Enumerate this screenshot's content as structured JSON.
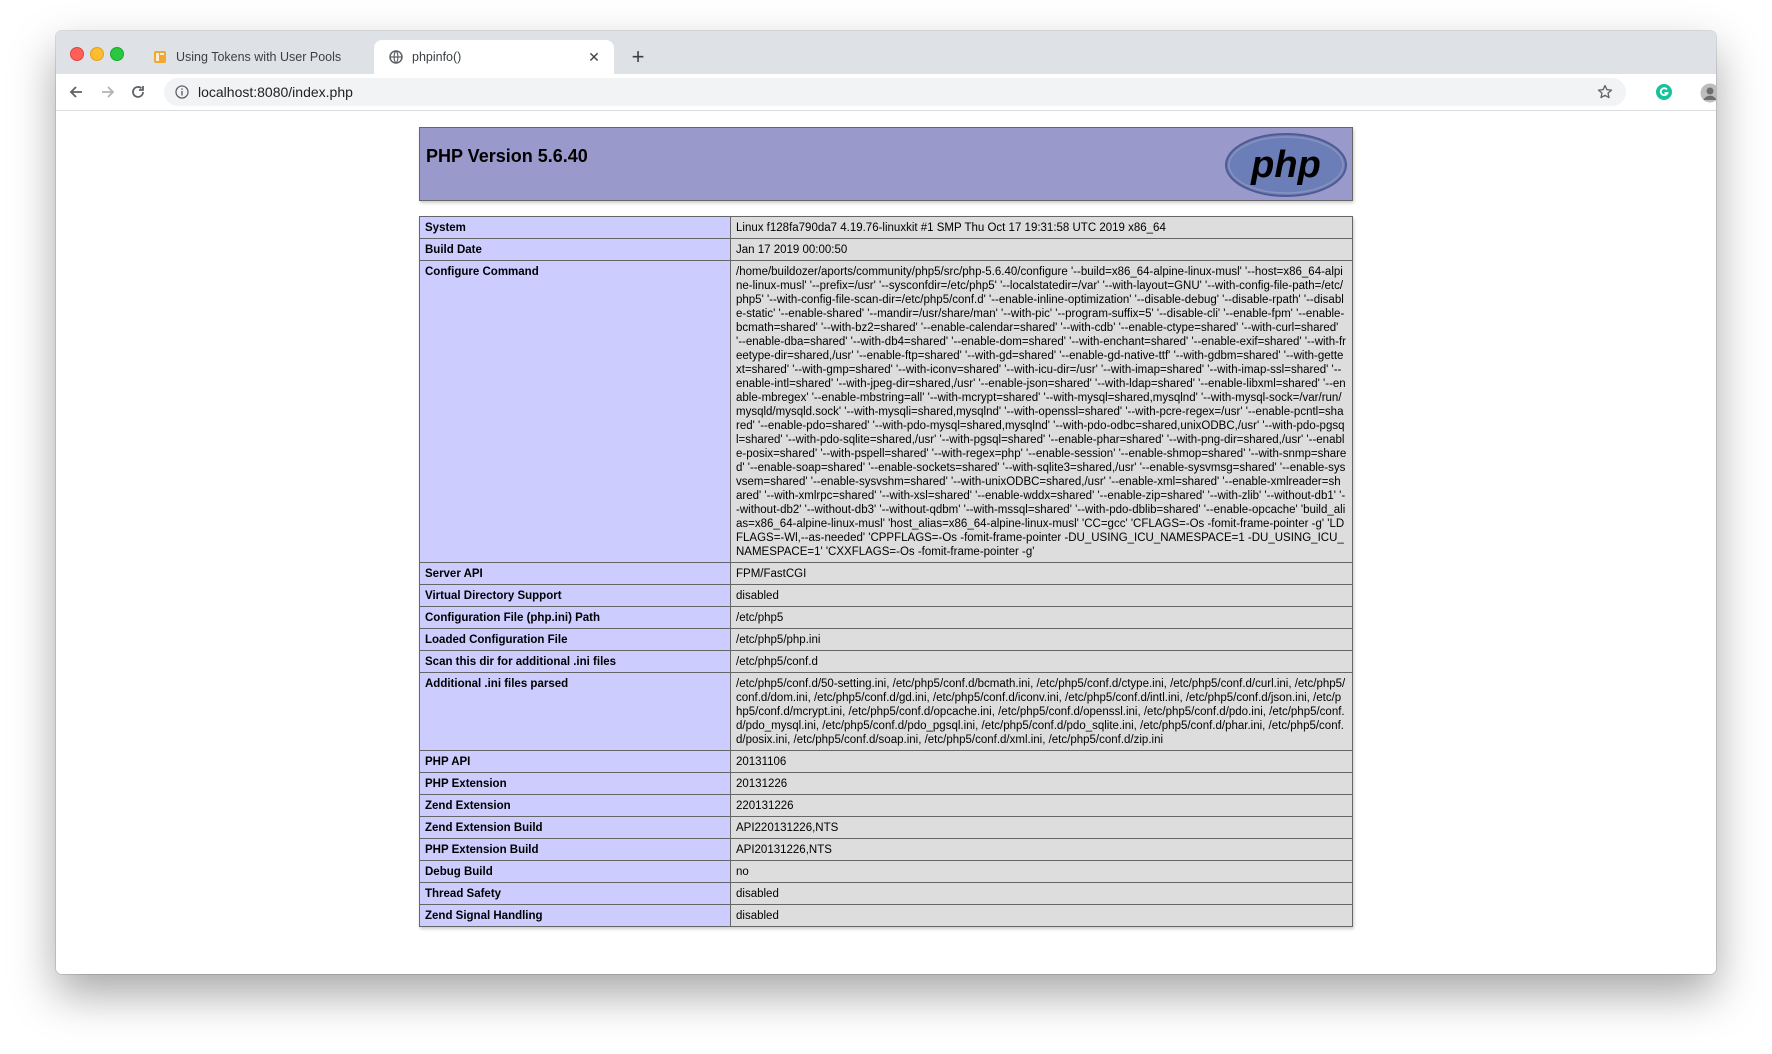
{
  "browser": {
    "tabs": [
      {
        "title": "Using Tokens with User Pools",
        "active": false,
        "icon": "aws-docs-icon"
      },
      {
        "title": "phpinfo()",
        "active": true,
        "icon": "globe-icon"
      }
    ],
    "url": "localhost:8080/index.php",
    "new_tab_label": "+"
  },
  "php": {
    "version_title": "PHP Version 5.6.40",
    "logo_text": "php",
    "rows": [
      {
        "key": "System",
        "value": "Linux f128fa790da7 4.19.76-linuxkit #1 SMP Thu Oct 17 19:31:58 UTC 2019 x86_64"
      },
      {
        "key": "Build Date",
        "value": "Jan 17 2019 00:00:50"
      },
      {
        "key": "Configure Command",
        "value": "/home/buildozer/aports/community/php5/src/php-5.6.40/configure '--build=x86_64-alpine-linux-musl' '--host=x86_64-alpine-linux-musl' '--prefix=/usr' '--sysconfdir=/etc/php5' '--localstatedir=/var' '--with-layout=GNU' '--with-config-file-path=/etc/php5' '--with-config-file-scan-dir=/etc/php5/conf.d' '--enable-inline-optimization' '--disable-debug' '--disable-rpath' '--disable-static' '--enable-shared' '--mandir=/usr/share/man' '--with-pic' '--program-suffix=5' '--disable-cli' '--enable-fpm' '--enable-bcmath=shared' '--with-bz2=shared' '--enable-calendar=shared' '--with-cdb' '--enable-ctype=shared' '--with-curl=shared' '--enable-dba=shared' '--with-db4=shared' '--enable-dom=shared' '--with-enchant=shared' '--enable-exif=shared' '--with-freetype-dir=shared,/usr' '--enable-ftp=shared' '--with-gd=shared' '--enable-gd-native-ttf' '--with-gdbm=shared' '--with-gettext=shared' '--with-gmp=shared' '--with-iconv=shared' '--with-icu-dir=/usr' '--with-imap=shared' '--with-imap-ssl=shared' '--enable-intl=shared' '--with-jpeg-dir=shared,/usr' '--enable-json=shared' '--with-ldap=shared' '--enable-libxml=shared' '--enable-mbregex' '--enable-mbstring=all' '--with-mcrypt=shared' '--with-mysql=shared,mysqlnd' '--with-mysql-sock=/var/run/mysqld/mysqld.sock' '--with-mysqli=shared,mysqlnd' '--with-openssl=shared' '--with-pcre-regex=/usr' '--enable-pcntl=shared' '--enable-pdo=shared' '--with-pdo-mysql=shared,mysqlnd' '--with-pdo-odbc=shared,unixODBC,/usr' '--with-pdo-pgsql=shared' '--with-pdo-sqlite=shared,/usr' '--with-pgsql=shared' '--enable-phar=shared' '--with-png-dir=shared,/usr' '--enable-posix=shared' '--with-pspell=shared' '--with-regex=php' '--enable-session' '--enable-shmop=shared' '--with-snmp=shared' '--enable-soap=shared' '--enable-sockets=shared' '--with-sqlite3=shared,/usr' '--enable-sysvmsg=shared' '--enable-sysvsem=shared' '--enable-sysvshm=shared' '--with-unixODBC=shared,/usr' '--enable-xml=shared' '--enable-xmlreader=shared' '--with-xmlrpc=shared' '--with-xsl=shared' '--enable-wddx=shared' '--enable-zip=shared' '--with-zlib' '--without-db1' '--without-db2' '--without-db3' '--without-qdbm' '--with-mssql=shared' '--with-pdo-dblib=shared' '--enable-opcache' 'build_alias=x86_64-alpine-linux-musl' 'host_alias=x86_64-alpine-linux-musl' 'CC=gcc' 'CFLAGS=-Os -fomit-frame-pointer -g' 'LDFLAGS=-Wl,--as-needed' 'CPPFLAGS=-Os -fomit-frame-pointer -DU_USING_ICU_NAMESPACE=1 -DU_USING_ICU_NAMESPACE=1' 'CXXFLAGS=-Os -fomit-frame-pointer -g'"
      },
      {
        "key": "Server API",
        "value": "FPM/FastCGI"
      },
      {
        "key": "Virtual Directory Support",
        "value": "disabled"
      },
      {
        "key": "Configuration File (php.ini) Path",
        "value": "/etc/php5"
      },
      {
        "key": "Loaded Configuration File",
        "value": "/etc/php5/php.ini"
      },
      {
        "key": "Scan this dir for additional .ini files",
        "value": "/etc/php5/conf.d"
      },
      {
        "key": "Additional .ini files parsed",
        "value": "/etc/php5/conf.d/50-setting.ini, /etc/php5/conf.d/bcmath.ini, /etc/php5/conf.d/ctype.ini, /etc/php5/conf.d/curl.ini, /etc/php5/conf.d/dom.ini, /etc/php5/conf.d/gd.ini, /etc/php5/conf.d/iconv.ini, /etc/php5/conf.d/intl.ini, /etc/php5/conf.d/json.ini, /etc/php5/conf.d/mcrypt.ini, /etc/php5/conf.d/opcache.ini, /etc/php5/conf.d/openssl.ini, /etc/php5/conf.d/pdo.ini, /etc/php5/conf.d/pdo_mysql.ini, /etc/php5/conf.d/pdo_pgsql.ini, /etc/php5/conf.d/pdo_sqlite.ini, /etc/php5/conf.d/phar.ini, /etc/php5/conf.d/posix.ini, /etc/php5/conf.d/soap.ini, /etc/php5/conf.d/xml.ini, /etc/php5/conf.d/zip.ini"
      },
      {
        "key": "PHP API",
        "value": "20131106"
      },
      {
        "key": "PHP Extension",
        "value": "20131226"
      },
      {
        "key": "Zend Extension",
        "value": "220131226"
      },
      {
        "key": "Zend Extension Build",
        "value": "API220131226,NTS"
      },
      {
        "key": "PHP Extension Build",
        "value": "API20131226,NTS"
      },
      {
        "key": "Debug Build",
        "value": "no"
      },
      {
        "key": "Thread Safety",
        "value": "disabled"
      },
      {
        "key": "Zend Signal Handling",
        "value": "disabled"
      }
    ]
  },
  "colors": {
    "header_bg": "#9999cc",
    "key_bg": "#ccccff",
    "value_bg": "#dddddd",
    "border": "#666666"
  }
}
